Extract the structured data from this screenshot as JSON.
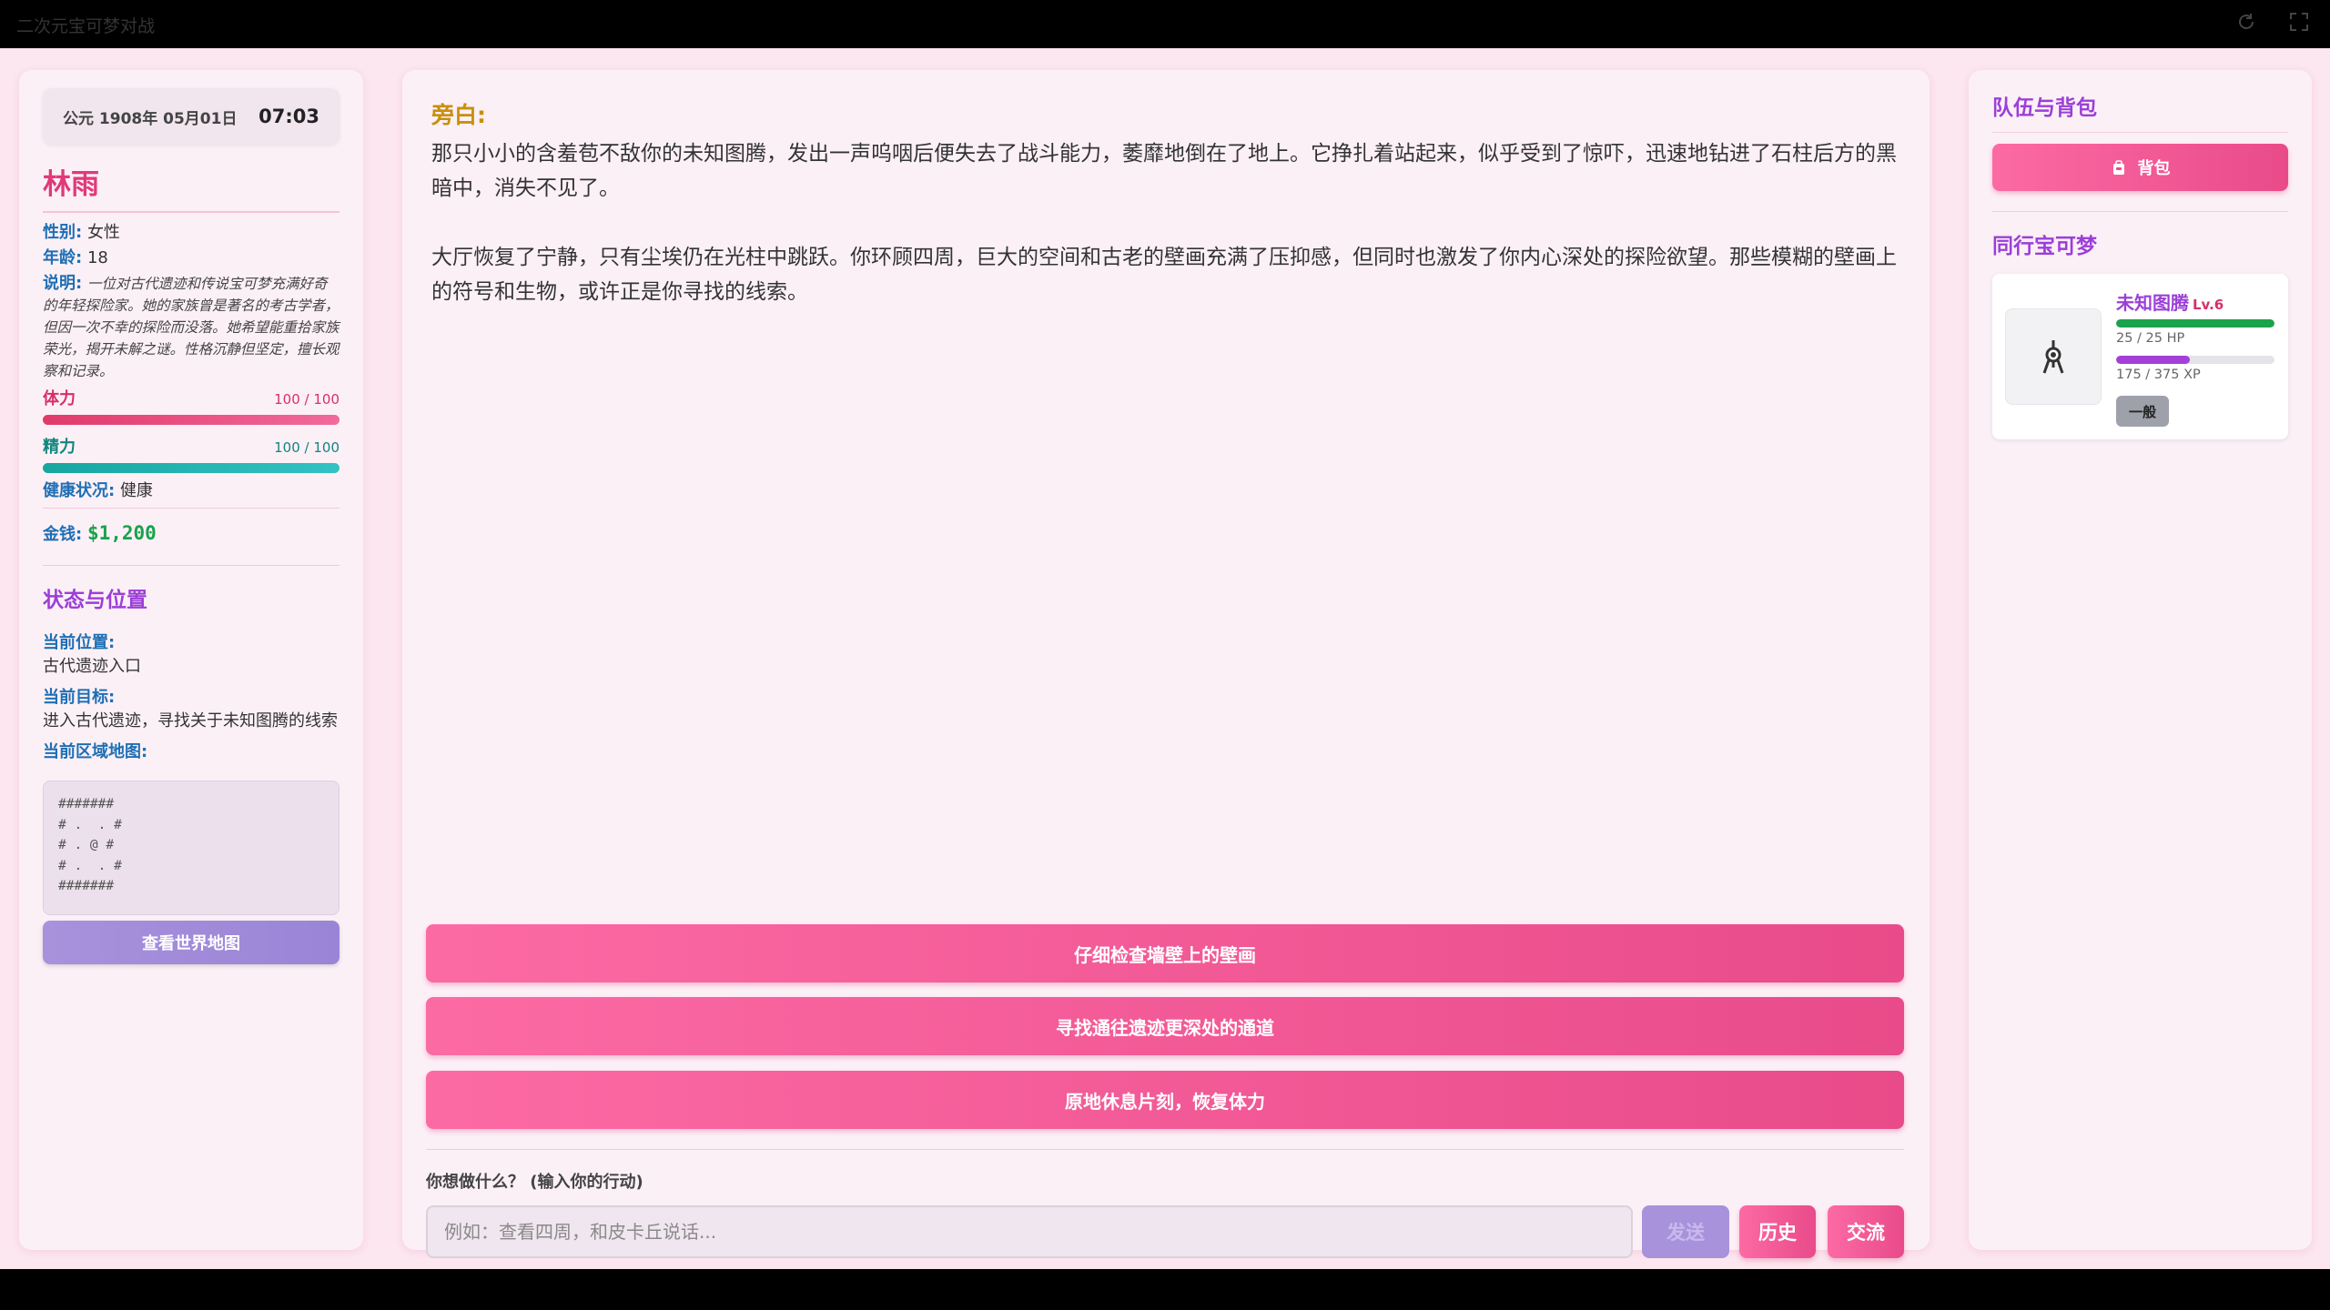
{
  "window": {
    "title": "二次元宝可梦对战"
  },
  "left": {
    "date": "公元 1908年 05月01日",
    "time": "07:03",
    "name": "林雨",
    "gender_label": "性别:",
    "gender": "女性",
    "age_label": "年龄:",
    "age": "18",
    "desc_label": "说明:",
    "desc": "一位对古代遗迹和传说宝可梦充满好奇的年轻探险家。她的家族曾是著名的考古学者，但因一次不幸的探险而没落。她希望能重拾家族荣光，揭开未解之谜。性格沉静但坚定，擅长观察和记录。",
    "hp": {
      "label": "体力",
      "value": "100 / 100",
      "fraction": 1.0
    },
    "mp": {
      "label": "精力",
      "value": "100 / 100",
      "fraction": 1.0
    },
    "health_label": "健康状况:",
    "health": "健康",
    "money_label": "金钱:",
    "money": "$1,200",
    "status_title": "状态与位置",
    "location_label": "当前位置:",
    "location": "古代遗迹入口",
    "goal_label": "当前目标:",
    "goal": "进入古代遗迹，寻找关于未知图腾的线索",
    "map_label": "当前区域地图:",
    "map": "#######\n# .  . #\n# . @ #\n# .  . #\n#######",
    "world_map_button": "查看世界地图"
  },
  "center": {
    "narration_title": "旁白:",
    "paragraphs": [
      "那只小小的含羞苞不敌你的未知图腾，发出一声呜咽后便失去了战斗能力，萎靡地倒在了地上。它挣扎着站起来，似乎受到了惊吓，迅速地钻进了石柱后方的黑暗中，消失不见了。",
      "大厅恢复了宁静，只有尘埃仍在光柱中跳跃。你环顾四周，巨大的空间和古老的壁画充满了压抑感，但同时也激发了你内心深处的探险欲望。那些模糊的壁画上的符号和生物，或许正是你寻找的线索。"
    ],
    "choices": [
      "仔细检查墙壁上的壁画",
      "寻找通往遗迹更深处的通道",
      "原地休息片刻，恢复体力"
    ],
    "ask_label": "你想做什么？ (输入你的行动)",
    "input_value": "",
    "input_placeholder": "例如：查看四周，和皮卡丘说话...",
    "send_button": "发送",
    "history_button": "历史",
    "chat_button": "交流"
  },
  "right": {
    "team_title": "队伍与背包",
    "bag_button": "背包",
    "companion_title": "同行宝可梦",
    "pokemon": {
      "name": "未知图腾",
      "level": "Lv.6",
      "hp_text": "25 / 25 HP",
      "hp_fraction": 1.0,
      "xp_text": "175 / 375 XP",
      "xp_fraction": 0.467,
      "tag": "一般"
    }
  },
  "colors": {
    "accent_pink": "#e94b8a",
    "accent_purple": "#9b3fd8",
    "background": "#fce7f0"
  },
  "icons": {
    "refresh": "refresh-icon",
    "fullscreen": "fullscreen-icon",
    "bag": "backpack-icon",
    "pokemon": "unown-sprite"
  }
}
